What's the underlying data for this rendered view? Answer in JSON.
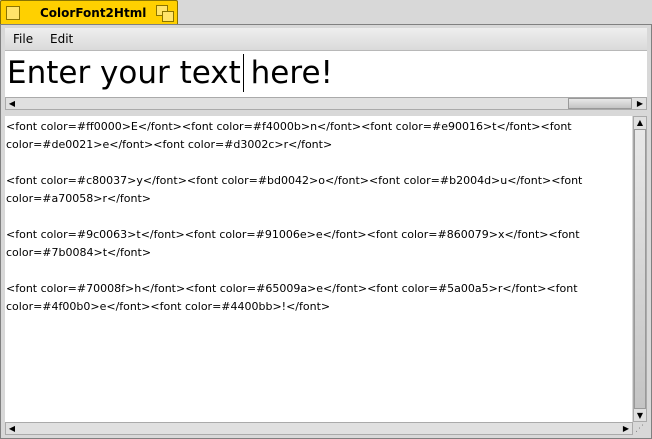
{
  "window": {
    "title": "ColorFont2Html"
  },
  "menu": {
    "file": "File",
    "edit": "Edit"
  },
  "input": {
    "text": "Enter your text here!"
  },
  "output": {
    "lines": [
      "<font color=#ff0000>E</font><font color=#f4000b>n</font><font color=#e90016>t</font><font",
      "color=#de0021>e</font><font color=#d3002c>r</font>",
      "",
      "<font color=#c80037>y</font><font color=#bd0042>o</font><font color=#b2004d>u</font><font",
      "color=#a70058>r</font>",
      "",
      "<font color=#9c0063>t</font><font color=#91006e>e</font><font color=#860079>x</font><font",
      "color=#7b0084>t</font>",
      "",
      "<font color=#70008f>h</font><font color=#65009a>e</font><font color=#5a00a5>r</font><font",
      "color=#4f00b0>e</font><font color=#4400bb>!</font>"
    ]
  },
  "colors": {
    "tab": "#ffd000",
    "background": "#d8d8d8"
  }
}
